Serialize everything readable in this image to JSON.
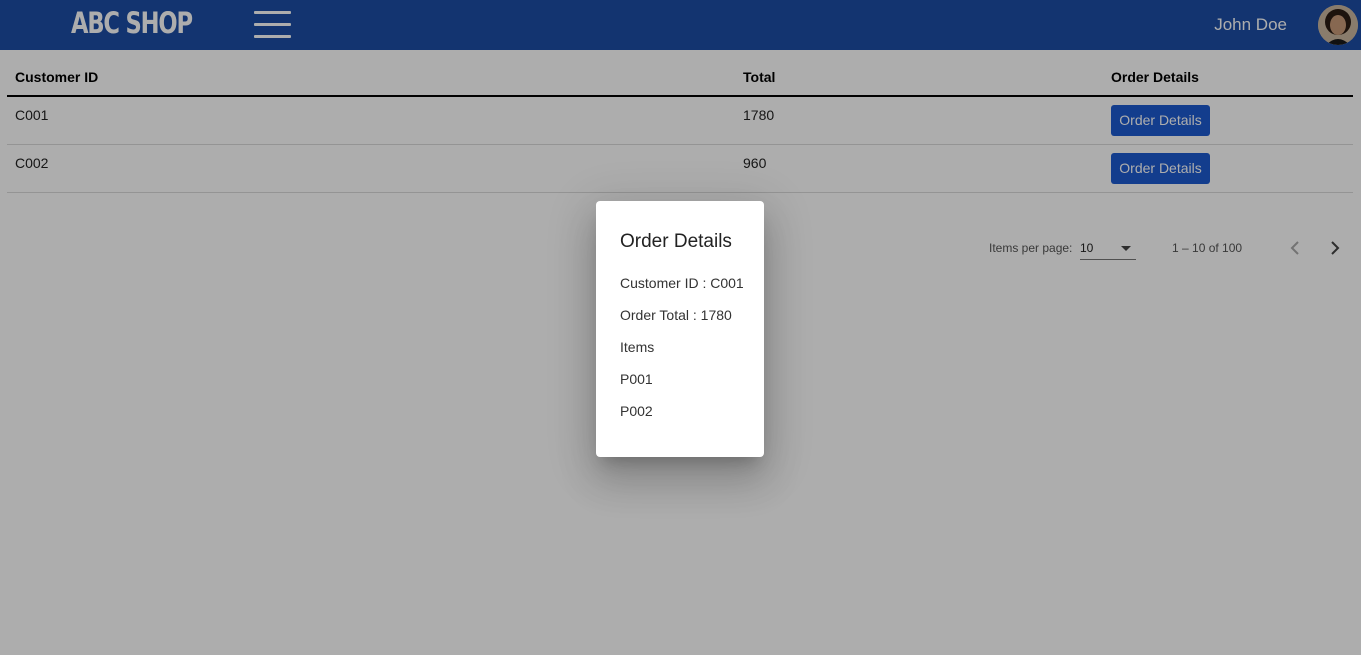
{
  "header": {
    "brand": "ABC SHOP",
    "user_name": "John Doe",
    "accent_color": "#1c4da5"
  },
  "table": {
    "columns": [
      "Customer ID",
      "Total",
      "Order Details"
    ],
    "rows": [
      {
        "customer_id": "C001",
        "total": "1780",
        "action_label": "Order Details"
      },
      {
        "customer_id": "C002",
        "total": "960",
        "action_label": "Order Details"
      }
    ]
  },
  "paginator": {
    "items_per_page_label": "Items per page:",
    "items_per_page_value": "10",
    "range_label": "1 – 10 of 100"
  },
  "dialog": {
    "title": "Order Details",
    "customer_line": "Customer ID : C001",
    "total_line": "Order Total : 1780",
    "items_heading": "Items",
    "items": [
      "P001",
      "P002"
    ]
  },
  "icons": {
    "menu": "hamburger-menu-icon",
    "avatar": "user-avatar",
    "dropdown": "dropdown-arrow-icon",
    "prev": "chevron-left-icon",
    "next": "chevron-right-icon"
  },
  "colors": {
    "button": "#1c5bd0",
    "backdrop": "rgba(0,0,0,0.32)"
  }
}
